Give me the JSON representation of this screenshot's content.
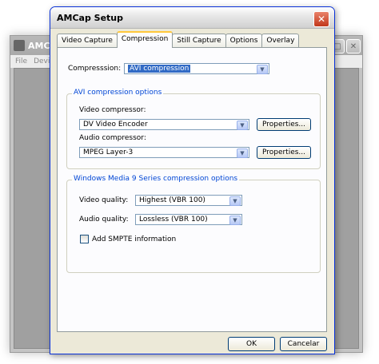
{
  "background_window": {
    "title": "AMCap",
    "menu": [
      "File",
      "Devic"
    ]
  },
  "dialog": {
    "title": "AMCap Setup",
    "tabs": [
      "Video Capture",
      "Compression",
      "Still Capture",
      "Options",
      "Overlay"
    ],
    "active_tab": "Compression",
    "compression_label": "Compresssion:",
    "compression_value": "AVI compression",
    "avi_group": {
      "title": "AVI compression options",
      "video_label": "Video compressor:",
      "video_value": "DV Video Encoder",
      "video_properties": "Properties...",
      "audio_label": "Audio compressor:",
      "audio_value": "MPEG Layer-3",
      "audio_properties": "Properties..."
    },
    "wm_group": {
      "title": "Windows Media 9 Series compression options",
      "video_quality_label": "Video quality:",
      "video_quality_value": "Highest (VBR 100)",
      "audio_quality_label": "Audio quality:",
      "audio_quality_value": "Lossless (VBR 100)",
      "smpte_label": "Add SMPTE information"
    },
    "ok_label": "OK",
    "cancel_label": "Cancelar"
  }
}
